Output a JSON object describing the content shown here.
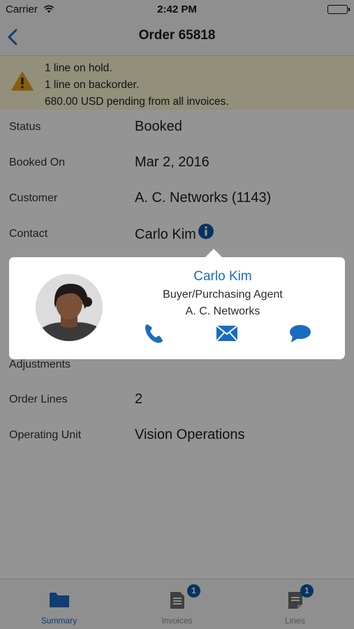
{
  "status_bar": {
    "carrier": "Carrier",
    "time": "2:42 PM"
  },
  "nav": {
    "title": "Order 65818",
    "back_icon": "chevron-left-icon"
  },
  "alert": {
    "icon": "warning-icon",
    "lines": [
      "1 line on hold.",
      "1 line on backorder.",
      "680.00 USD pending from all invoices."
    ]
  },
  "details": [
    {
      "label": "Status",
      "value": "Booked"
    },
    {
      "label": "Booked On",
      "value": "Mar 2, 2016"
    },
    {
      "label": "Customer",
      "value": "A. C. Networks (1143)"
    },
    {
      "label": "Contact",
      "value": "Carlo Kim"
    },
    {
      "label": "Adjustments",
      "value": ""
    },
    {
      "label": "Order Lines",
      "value": "2"
    },
    {
      "label": "Operating Unit",
      "value": "Vision Operations"
    }
  ],
  "contact_card": {
    "name": "Carlo Kim",
    "role": "Buyer/Purchasing Agent",
    "company": "A. C. Networks",
    "actions": [
      "phone-icon",
      "mail-icon",
      "chat-icon"
    ]
  },
  "tabs": [
    {
      "label": "Summary",
      "icon": "folder-icon",
      "active": true,
      "badge": ""
    },
    {
      "label": "Invoices",
      "icon": "invoice-icon",
      "active": false,
      "badge": "1"
    },
    {
      "label": "Lines",
      "icon": "note-icon",
      "active": false,
      "badge": "1"
    }
  ],
  "colors": {
    "accent": "#1a6cc1",
    "alert_bg": "#fbf7d5",
    "warning": "#e8a317",
    "badge": "#0a5aa8"
  }
}
